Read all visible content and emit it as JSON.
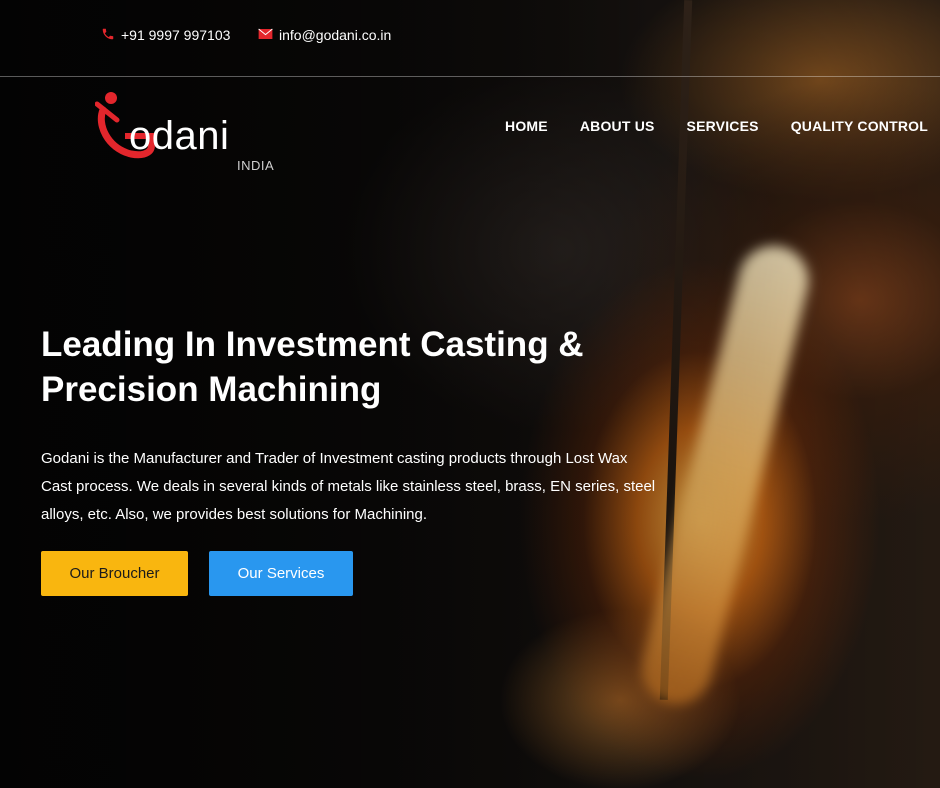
{
  "topbar": {
    "phone": "+91 9997 997103",
    "email": "info@godani.co.in",
    "phone_icon": "phone-icon",
    "email_icon": "envelope-icon"
  },
  "logo": {
    "word": "odani",
    "sub": "INDIA"
  },
  "nav": {
    "items": [
      {
        "label": "HOME"
      },
      {
        "label": "ABOUT US"
      },
      {
        "label": "SERVICES"
      },
      {
        "label": "QUALITY CONTROL"
      }
    ]
  },
  "hero": {
    "headline_line1": "Leading In Investment Casting &",
    "headline_line2": "Precision Machining",
    "intro": "Godani is the Manufacturer and Trader of Investment casting products through Lost Wax Cast process. We deals in several kinds of metals like stainless steel, brass, EN series, steel alloys, etc. Also, we provides best solutions for Machining.",
    "buttons": {
      "brochure": "Our Broucher",
      "services": "Our Services"
    }
  },
  "colors": {
    "brand_red": "#e3262c",
    "brochure_button": "#f9b60f",
    "services_button": "#2997ef"
  }
}
